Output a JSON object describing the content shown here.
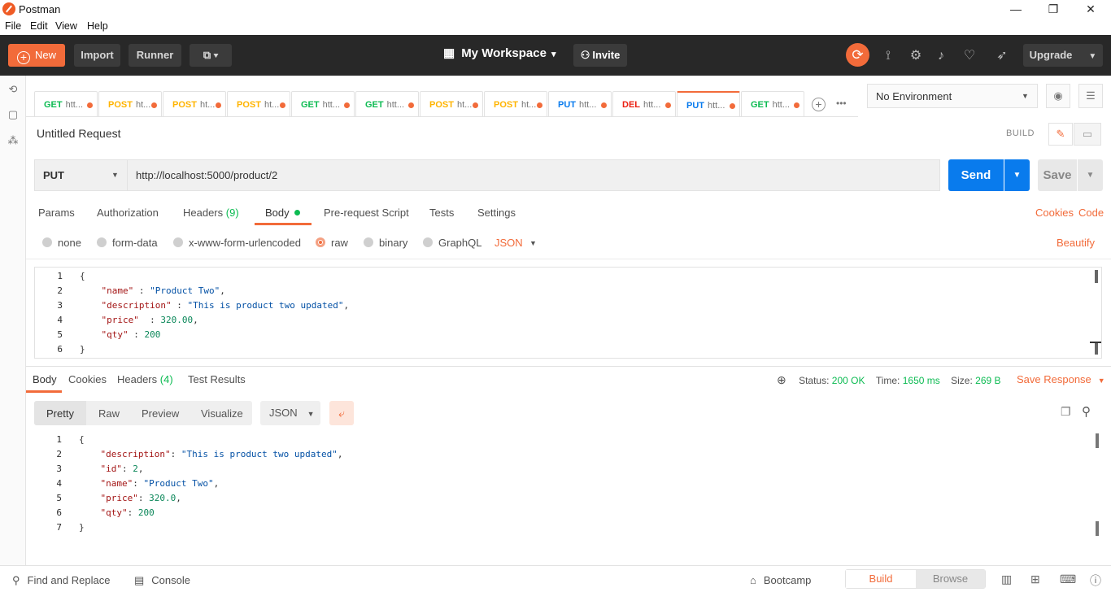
{
  "window": {
    "title": "Postman",
    "minimize": "—",
    "maximize": "❐",
    "close": "✕"
  },
  "menu": [
    "File",
    "Edit",
    "View",
    "Help"
  ],
  "header": {
    "new_label": "New",
    "import_label": "Import",
    "runner_label": "Runner",
    "workspace_label": "My Workspace",
    "invite_label": "Invite",
    "upgrade_label": "Upgrade"
  },
  "tabs": [
    {
      "method": "GET",
      "label": "htt..."
    },
    {
      "method": "POST",
      "label": "ht..."
    },
    {
      "method": "POST",
      "label": "ht..."
    },
    {
      "method": "POST",
      "label": "ht..."
    },
    {
      "method": "GET",
      "label": "htt..."
    },
    {
      "method": "GET",
      "label": "htt..."
    },
    {
      "method": "POST",
      "label": "ht..."
    },
    {
      "method": "POST",
      "label": "ht..."
    },
    {
      "method": "PUT",
      "label": "htt..."
    },
    {
      "method": "DEL",
      "label": "htt..."
    },
    {
      "method": "PUT",
      "label": "htt...",
      "active": true
    },
    {
      "method": "GET",
      "label": "htt..."
    }
  ],
  "environment": {
    "selected": "No Environment"
  },
  "request": {
    "title": "Untitled Request",
    "build_label": "BUILD",
    "method": "PUT",
    "url": "http://localhost:5000/product/2",
    "send_label": "Send",
    "save_label": "Save",
    "tabs": {
      "params": "Params",
      "authorization": "Authorization",
      "headers": "Headers",
      "headers_count": "(9)",
      "body": "Body",
      "prerequest": "Pre-request Script",
      "tests": "Tests",
      "settings": "Settings"
    },
    "cookies_link": "Cookies",
    "code_link": "Code",
    "body_modes": {
      "none": "none",
      "form_data": "form-data",
      "urlencoded": "x-www-form-urlencoded",
      "raw": "raw",
      "binary": "binary",
      "graphql": "GraphQL",
      "selected": "raw"
    },
    "body_type": "JSON",
    "beautify_link": "Beautify",
    "body_lines": [
      {
        "n": "1",
        "text": "{"
      },
      {
        "n": "2",
        "key": "\"name\"",
        "sep": " : ",
        "val": "\"Product Two\"",
        "vtype": "s",
        "end": ","
      },
      {
        "n": "3",
        "key": "\"description\"",
        "sep": " : ",
        "val": "\"This is product two updated\"",
        "vtype": "s",
        "end": ","
      },
      {
        "n": "4",
        "key": "\"price\"",
        "sep": "  : ",
        "val": "320.00",
        "vtype": "n",
        "end": ","
      },
      {
        "n": "5",
        "key": "\"qty\"",
        "sep": " : ",
        "val": "200",
        "vtype": "n",
        "end": ""
      },
      {
        "n": "6",
        "text": "}"
      }
    ]
  },
  "response": {
    "tabs": {
      "body": "Body",
      "cookies": "Cookies",
      "headers": "Headers",
      "headers_count": "(4)",
      "test_results": "Test Results"
    },
    "status_label": "Status:",
    "status_value": "200 OK",
    "time_label": "Time:",
    "time_value": "1650 ms",
    "size_label": "Size:",
    "size_value": "269 B",
    "save_response": "Save Response",
    "formats": {
      "pretty": "Pretty",
      "raw": "Raw",
      "preview": "Preview",
      "visualize": "Visualize"
    },
    "type": "JSON",
    "body_lines": [
      {
        "n": "1",
        "text": "{"
      },
      {
        "n": "2",
        "key": "\"description\"",
        "sep": ": ",
        "val": "\"This is product two updated\"",
        "vtype": "s",
        "end": ","
      },
      {
        "n": "3",
        "key": "\"id\"",
        "sep": ": ",
        "val": "2",
        "vtype": "n",
        "end": ","
      },
      {
        "n": "4",
        "key": "\"name\"",
        "sep": ": ",
        "val": "\"Product Two\"",
        "vtype": "s",
        "end": ","
      },
      {
        "n": "5",
        "key": "\"price\"",
        "sep": ": ",
        "val": "320.0",
        "vtype": "n",
        "end": ","
      },
      {
        "n": "6",
        "key": "\"qty\"",
        "sep": ": ",
        "val": "200",
        "vtype": "n",
        "end": ""
      },
      {
        "n": "7",
        "text": "}"
      }
    ]
  },
  "footer": {
    "find_replace": "Find and Replace",
    "console": "Console",
    "bootcamp": "Bootcamp",
    "build": "Build",
    "browse": "Browse"
  },
  "colors": {
    "accent": "#f26b3a",
    "send_blue": "#097bed",
    "get": "#0cbb52",
    "post": "#ffb400",
    "put": "#097bed",
    "delete": "#eb2013"
  }
}
